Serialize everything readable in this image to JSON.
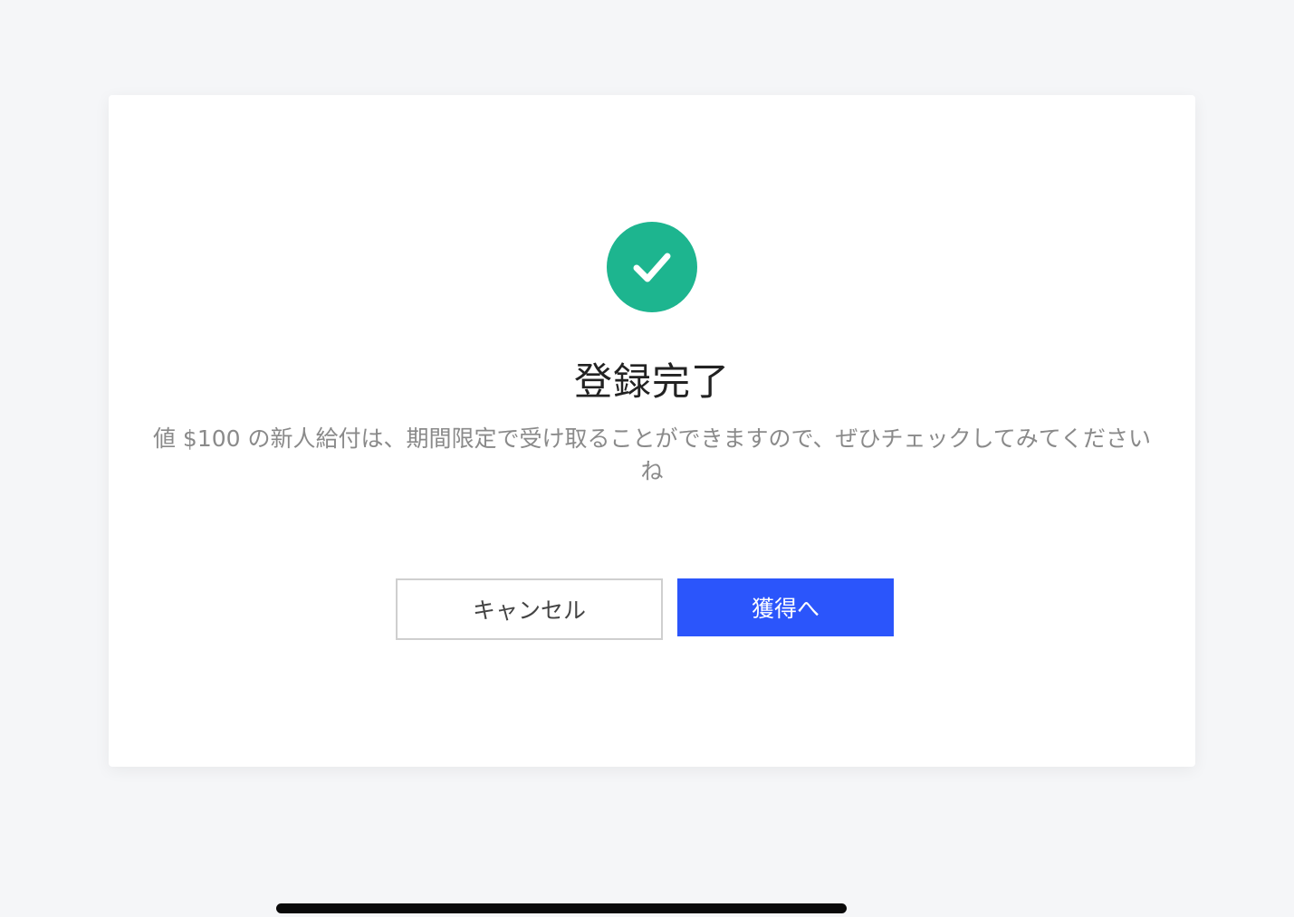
{
  "dialog": {
    "title": "登録完了",
    "message": "値 $100 の新人給付は、期間限定で受け取ることができますので、ぜひチェックしてみてください ね",
    "cancel_label": "キャンセル",
    "primary_label": "獲得へ"
  },
  "icons": {
    "success": "check-circle-icon"
  },
  "colors": {
    "page_background": "#f5f6f8",
    "success": "#1db58f",
    "primary": "#2b55fb",
    "title_text": "#222222",
    "message_text": "#8a8a8a"
  }
}
